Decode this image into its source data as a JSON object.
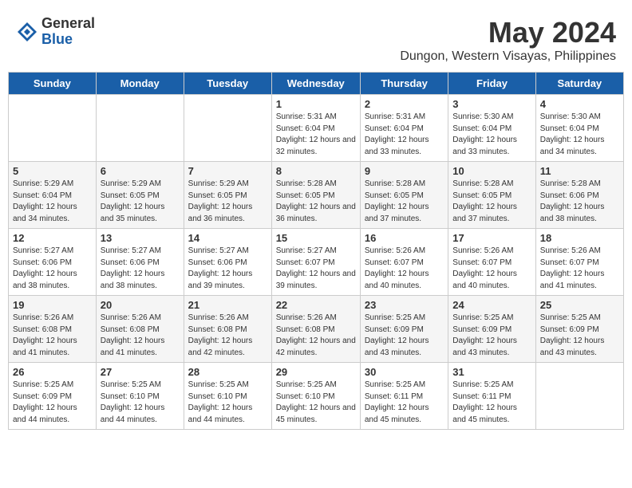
{
  "logo": {
    "text_general": "General",
    "text_blue": "Blue"
  },
  "title": "May 2024",
  "subtitle": "Dungon, Western Visayas, Philippines",
  "days_of_week": [
    "Sunday",
    "Monday",
    "Tuesday",
    "Wednesday",
    "Thursday",
    "Friday",
    "Saturday"
  ],
  "weeks": [
    [
      {
        "day": "",
        "info": ""
      },
      {
        "day": "",
        "info": ""
      },
      {
        "day": "",
        "info": ""
      },
      {
        "day": "1",
        "info": "Sunrise: 5:31 AM\nSunset: 6:04 PM\nDaylight: 12 hours\nand 32 minutes."
      },
      {
        "day": "2",
        "info": "Sunrise: 5:31 AM\nSunset: 6:04 PM\nDaylight: 12 hours\nand 33 minutes."
      },
      {
        "day": "3",
        "info": "Sunrise: 5:30 AM\nSunset: 6:04 PM\nDaylight: 12 hours\nand 33 minutes."
      },
      {
        "day": "4",
        "info": "Sunrise: 5:30 AM\nSunset: 6:04 PM\nDaylight: 12 hours\nand 34 minutes."
      }
    ],
    [
      {
        "day": "5",
        "info": "Sunrise: 5:29 AM\nSunset: 6:04 PM\nDaylight: 12 hours\nand 34 minutes."
      },
      {
        "day": "6",
        "info": "Sunrise: 5:29 AM\nSunset: 6:05 PM\nDaylight: 12 hours\nand 35 minutes."
      },
      {
        "day": "7",
        "info": "Sunrise: 5:29 AM\nSunset: 6:05 PM\nDaylight: 12 hours\nand 36 minutes."
      },
      {
        "day": "8",
        "info": "Sunrise: 5:28 AM\nSunset: 6:05 PM\nDaylight: 12 hours\nand 36 minutes."
      },
      {
        "day": "9",
        "info": "Sunrise: 5:28 AM\nSunset: 6:05 PM\nDaylight: 12 hours\nand 37 minutes."
      },
      {
        "day": "10",
        "info": "Sunrise: 5:28 AM\nSunset: 6:05 PM\nDaylight: 12 hours\nand 37 minutes."
      },
      {
        "day": "11",
        "info": "Sunrise: 5:28 AM\nSunset: 6:06 PM\nDaylight: 12 hours\nand 38 minutes."
      }
    ],
    [
      {
        "day": "12",
        "info": "Sunrise: 5:27 AM\nSunset: 6:06 PM\nDaylight: 12 hours\nand 38 minutes."
      },
      {
        "day": "13",
        "info": "Sunrise: 5:27 AM\nSunset: 6:06 PM\nDaylight: 12 hours\nand 38 minutes."
      },
      {
        "day": "14",
        "info": "Sunrise: 5:27 AM\nSunset: 6:06 PM\nDaylight: 12 hours\nand 39 minutes."
      },
      {
        "day": "15",
        "info": "Sunrise: 5:27 AM\nSunset: 6:07 PM\nDaylight: 12 hours\nand 39 minutes."
      },
      {
        "day": "16",
        "info": "Sunrise: 5:26 AM\nSunset: 6:07 PM\nDaylight: 12 hours\nand 40 minutes."
      },
      {
        "day": "17",
        "info": "Sunrise: 5:26 AM\nSunset: 6:07 PM\nDaylight: 12 hours\nand 40 minutes."
      },
      {
        "day": "18",
        "info": "Sunrise: 5:26 AM\nSunset: 6:07 PM\nDaylight: 12 hours\nand 41 minutes."
      }
    ],
    [
      {
        "day": "19",
        "info": "Sunrise: 5:26 AM\nSunset: 6:08 PM\nDaylight: 12 hours\nand 41 minutes."
      },
      {
        "day": "20",
        "info": "Sunrise: 5:26 AM\nSunset: 6:08 PM\nDaylight: 12 hours\nand 41 minutes."
      },
      {
        "day": "21",
        "info": "Sunrise: 5:26 AM\nSunset: 6:08 PM\nDaylight: 12 hours\nand 42 minutes."
      },
      {
        "day": "22",
        "info": "Sunrise: 5:26 AM\nSunset: 6:08 PM\nDaylight: 12 hours\nand 42 minutes."
      },
      {
        "day": "23",
        "info": "Sunrise: 5:25 AM\nSunset: 6:09 PM\nDaylight: 12 hours\nand 43 minutes."
      },
      {
        "day": "24",
        "info": "Sunrise: 5:25 AM\nSunset: 6:09 PM\nDaylight: 12 hours\nand 43 minutes."
      },
      {
        "day": "25",
        "info": "Sunrise: 5:25 AM\nSunset: 6:09 PM\nDaylight: 12 hours\nand 43 minutes."
      }
    ],
    [
      {
        "day": "26",
        "info": "Sunrise: 5:25 AM\nSunset: 6:09 PM\nDaylight: 12 hours\nand 44 minutes."
      },
      {
        "day": "27",
        "info": "Sunrise: 5:25 AM\nSunset: 6:10 PM\nDaylight: 12 hours\nand 44 minutes."
      },
      {
        "day": "28",
        "info": "Sunrise: 5:25 AM\nSunset: 6:10 PM\nDaylight: 12 hours\nand 44 minutes."
      },
      {
        "day": "29",
        "info": "Sunrise: 5:25 AM\nSunset: 6:10 PM\nDaylight: 12 hours\nand 45 minutes."
      },
      {
        "day": "30",
        "info": "Sunrise: 5:25 AM\nSunset: 6:11 PM\nDaylight: 12 hours\nand 45 minutes."
      },
      {
        "day": "31",
        "info": "Sunrise: 5:25 AM\nSunset: 6:11 PM\nDaylight: 12 hours\nand 45 minutes."
      },
      {
        "day": "",
        "info": ""
      }
    ]
  ]
}
